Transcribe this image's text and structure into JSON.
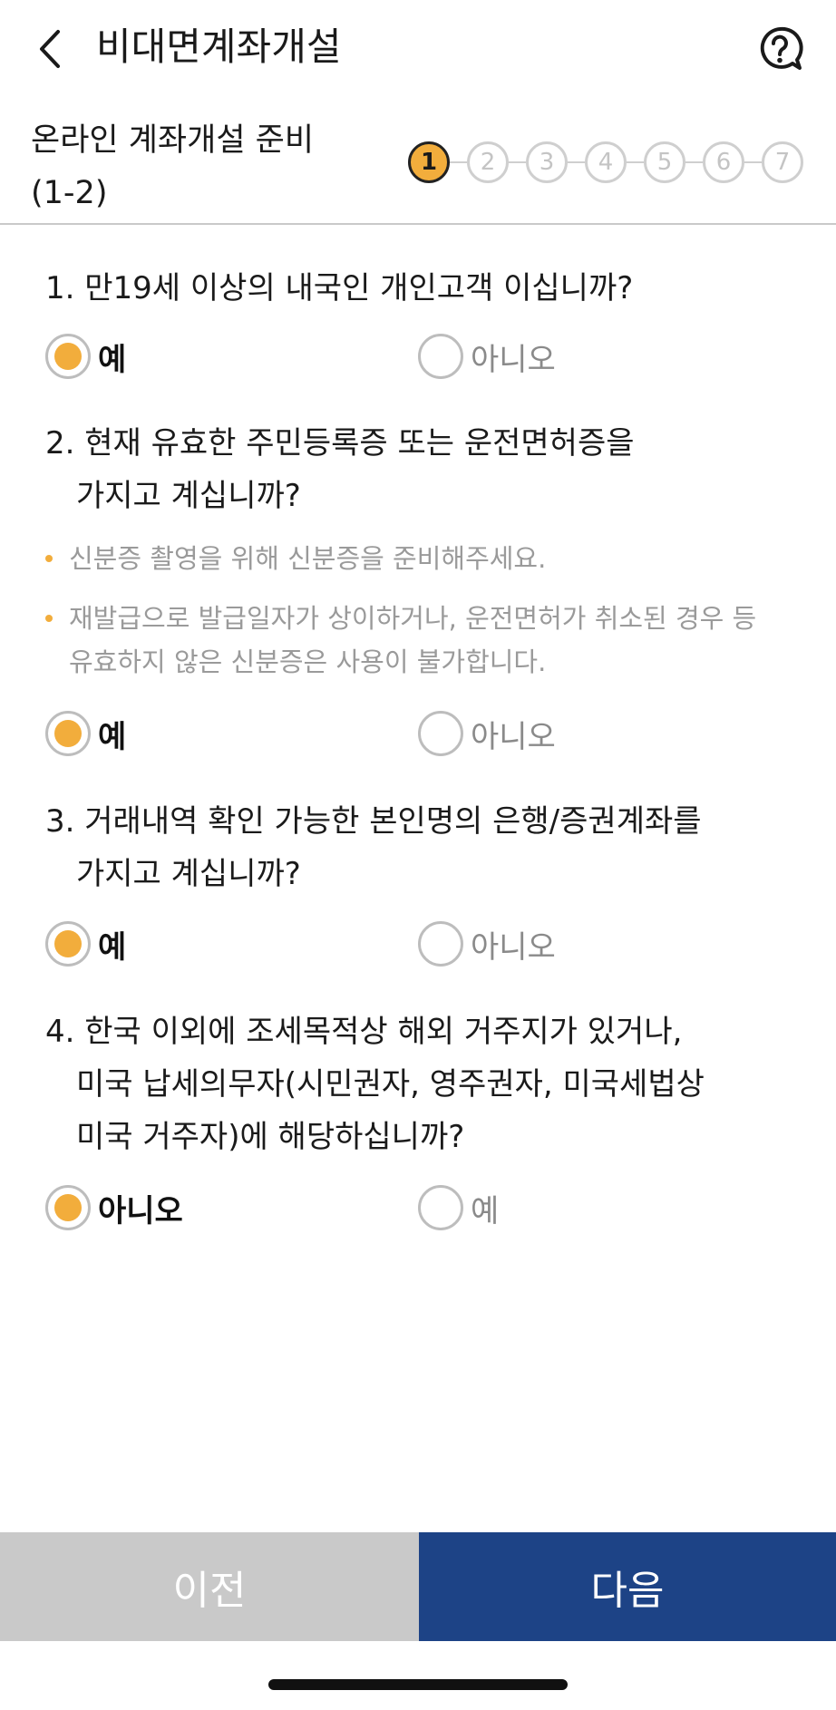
{
  "header": {
    "title": "비대면계좌개설",
    "back_icon": "chevron-left-icon",
    "help_icon": "question-bubble-icon"
  },
  "step_header": {
    "title_line1": "온라인 계좌개설 준비",
    "title_line2": "(1-2)",
    "steps": [
      "1",
      "2",
      "3",
      "4",
      "5",
      "6",
      "7"
    ],
    "active_step": 1
  },
  "questions": [
    {
      "line1": "1. 만19세 이상의 내국인 개인고객 이십니까?",
      "options": [
        {
          "label": "예",
          "checked": true
        },
        {
          "label": "아니오",
          "checked": false
        }
      ]
    },
    {
      "line1": "2. 현재 유효한 주민등록증 또는 운전면허증을",
      "line2": "가지고 계십니까?",
      "notes": [
        {
          "line1": "신분증 촬영을 위해 신분증을 준비해주세요."
        },
        {
          "line1": "재발급으로 발급일자가 상이하거나, 운전면허가 취소된 경우 등",
          "line2": "유효하지 않은 신분증은 사용이 불가합니다."
        }
      ],
      "options": [
        {
          "label": "예",
          "checked": true
        },
        {
          "label": "아니오",
          "checked": false
        }
      ]
    },
    {
      "line1": "3. 거래내역 확인 가능한 본인명의 은행/증권계좌를",
      "line2": "가지고 계십니까?",
      "options": [
        {
          "label": "예",
          "checked": true
        },
        {
          "label": "아니오",
          "checked": false
        }
      ]
    },
    {
      "line1": "4. 한국 이외에 조세목적상 해외 거주지가 있거나,",
      "line2": "미국 납세의무자(시민권자, 영주권자, 미국세법상",
      "line3": "미국 거주자)에 해당하십니까?",
      "options": [
        {
          "label": "아니오",
          "checked": true
        },
        {
          "label": "예",
          "checked": false
        }
      ]
    }
  ],
  "footer": {
    "prev_label": "이전",
    "next_label": "다음"
  },
  "colors": {
    "accent": "#f2ad3c",
    "primary": "#1d4386",
    "disabled": "#c9c9c9"
  }
}
